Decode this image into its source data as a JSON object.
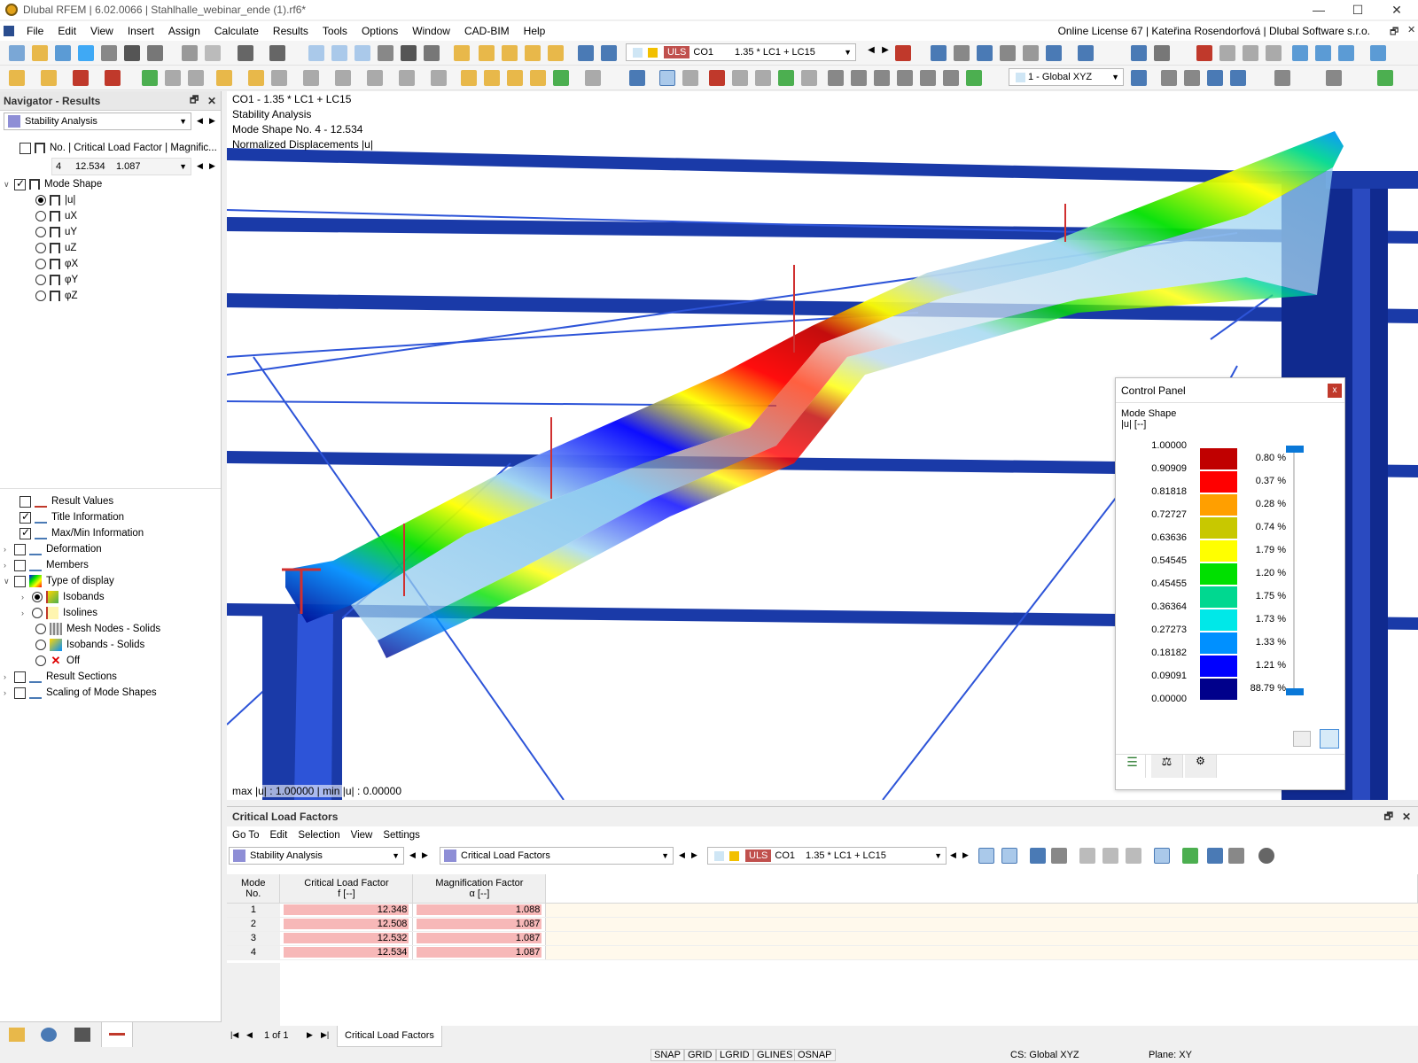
{
  "app": {
    "title": "Dlubal RFEM | 6.02.0066 | Stahlhalle_webinar_ende (1).rf6*",
    "license": "Online License 67 | Kateřina Rosendorfová | Dlubal Software s.r.o."
  },
  "menu": [
    "File",
    "Edit",
    "View",
    "Insert",
    "Assign",
    "Calculate",
    "Results",
    "Tools",
    "Options",
    "Window",
    "CAD-BIM",
    "Help"
  ],
  "toolbar": {
    "load_type": "ULS",
    "load_case": "CO1",
    "combination": "1.35 * LC1 + LC15",
    "coord_system": "1 - Global XYZ"
  },
  "navigator": {
    "title": "Navigator - Results",
    "analysis": "Stability Analysis",
    "factor_header": "No. | Critical Load Factor | Magnific...",
    "factor_row": {
      "no": "4",
      "factor": "12.534",
      "magnification": "1.087"
    },
    "mode_shape": "Mode Shape",
    "components": [
      "|u|",
      "uX",
      "uY",
      "uZ",
      "φX",
      "φY",
      "φZ"
    ],
    "bottom_items": [
      "Result Values",
      "Title Information",
      "Max/Min Information",
      "Deformation",
      "Members",
      "Type of display",
      "Isobands",
      "Isolines",
      "Mesh Nodes - Solids",
      "Isobands - Solids",
      "Off",
      "Result Sections",
      "Scaling of Mode Shapes"
    ]
  },
  "view": {
    "info_lines": [
      "CO1 - 1.35 * LC1 + LC15",
      "Stability Analysis",
      "Mode Shape No. 4 - 12.534",
      "Normalized Displacements |u|"
    ],
    "maxmin": "max |u| : 1.00000 | min |u| : 0.00000"
  },
  "control_panel": {
    "title": "Control Panel",
    "subtitle": "Mode Shape",
    "unit": "|u| [--]",
    "values": [
      "1.00000",
      "0.90909",
      "0.81818",
      "0.72727",
      "0.63636",
      "0.54545",
      "0.45455",
      "0.36364",
      "0.27273",
      "0.18182",
      "0.09091",
      "0.00000"
    ],
    "colors": [
      "#c00000",
      "#ff0000",
      "#ff9f00",
      "#c8c800",
      "#ffff00",
      "#00e000",
      "#00d890",
      "#00e8e8",
      "#0090ff",
      "#0000ff",
      "#00008b"
    ],
    "percents": [
      "0.80 %",
      "0.37 %",
      "0.28 %",
      "0.74 %",
      "1.79 %",
      "1.20 %",
      "1.75 %",
      "1.73 %",
      "1.33 %",
      "1.21 %",
      "88.79 %"
    ]
  },
  "results_panel": {
    "title": "Critical Load Factors",
    "menu": [
      "Go To",
      "Edit",
      "Selection",
      "View",
      "Settings"
    ],
    "analysis": "Stability Analysis",
    "table_name": "Critical Load Factors",
    "columns": [
      {
        "h1": "Mode",
        "h2": "No."
      },
      {
        "h1": "Critical Load Factor",
        "h2": "f [--]"
      },
      {
        "h1": "Magnification Factor",
        "h2": "α [--]"
      }
    ],
    "rows": [
      {
        "no": "1",
        "f": "12.348",
        "a": "1.088"
      },
      {
        "no": "2",
        "f": "12.508",
        "a": "1.087"
      },
      {
        "no": "3",
        "f": "12.532",
        "a": "1.087"
      },
      {
        "no": "4",
        "f": "12.534",
        "a": "1.087"
      }
    ],
    "page": "1 of 1",
    "tab": "Critical Load Factors"
  },
  "status": {
    "items": [
      "SNAP",
      "GRID",
      "LGRID",
      "GLINES",
      "OSNAP"
    ],
    "cs": "CS: Global XYZ",
    "plane": "Plane: XY"
  }
}
